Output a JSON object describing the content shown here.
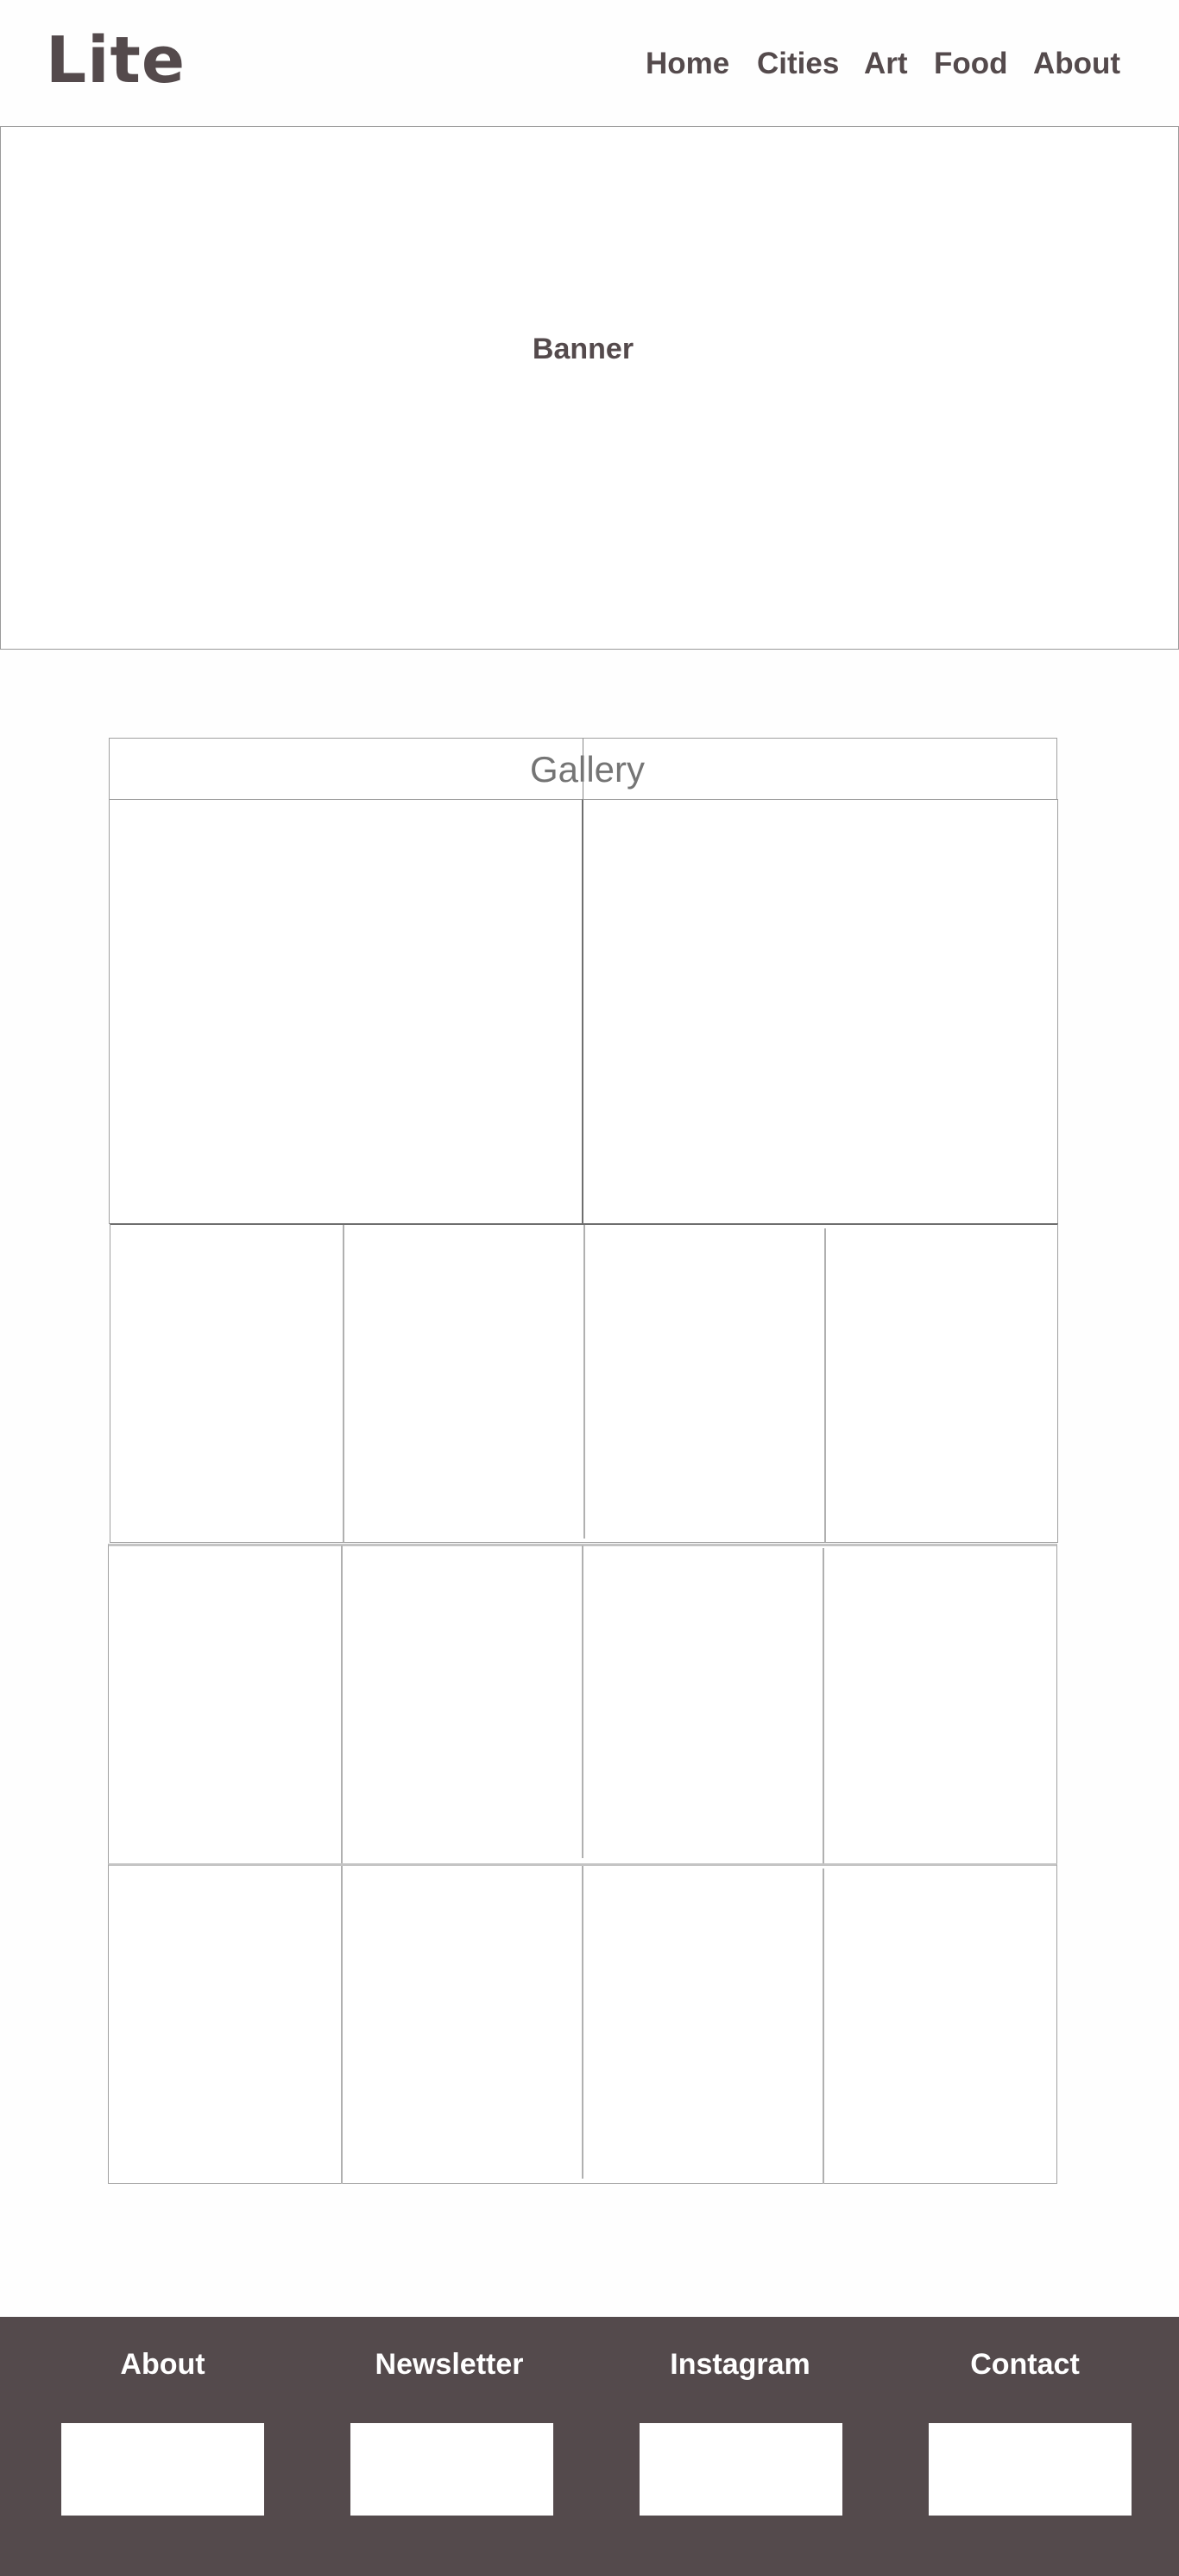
{
  "header": {
    "logo": "Lite",
    "nav": [
      "Home",
      "Cities",
      "Art",
      "Food",
      "About"
    ]
  },
  "banner": {
    "label": "Banner"
  },
  "gallery": {
    "title": "Gallery"
  },
  "footer": {
    "columns": [
      "About",
      "Newsletter",
      "Instagram",
      "Contact"
    ]
  },
  "colors": {
    "primary": "#544a4c",
    "background": "#fefefe",
    "border": "#a0a0a0",
    "gallery_title": "#757575"
  }
}
